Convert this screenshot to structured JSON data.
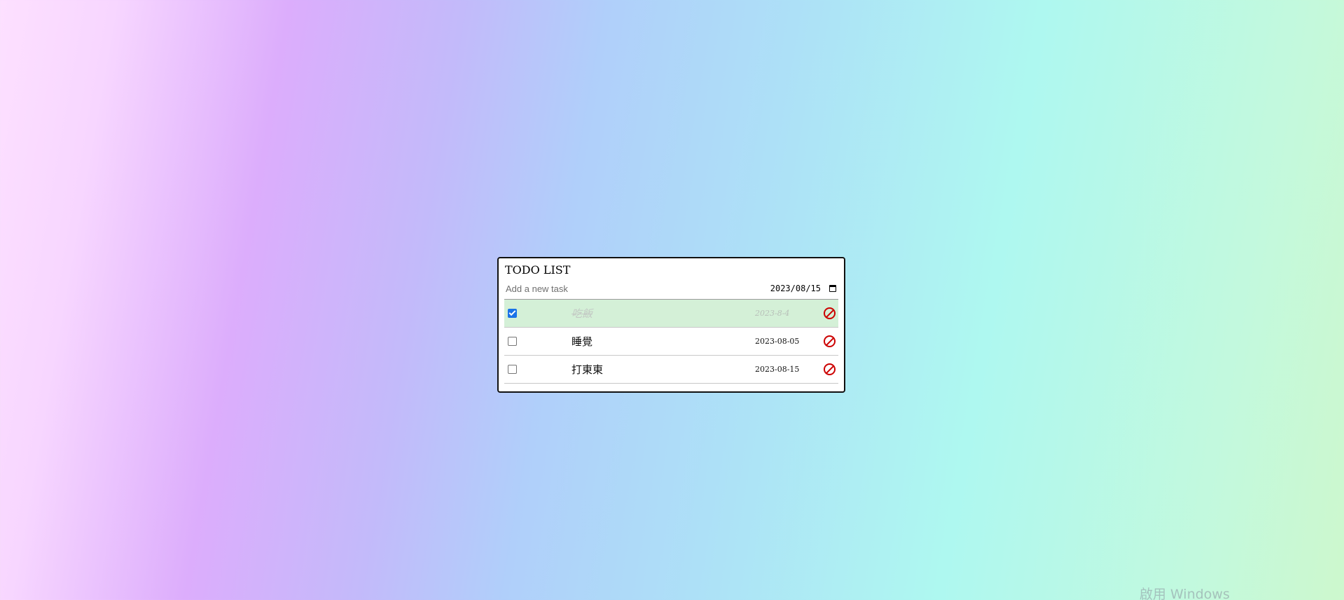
{
  "app": {
    "title": "TODO LIST"
  },
  "add_task": {
    "placeholder": "Add a new task",
    "date_value": "2023/08/15"
  },
  "tasks": [
    {
      "name": "吃飯",
      "date": "2023-8-4",
      "checked": true
    },
    {
      "name": "睡覺",
      "date": "2023-08-05",
      "checked": false
    },
    {
      "name": "打東東",
      "date": "2023-08-15",
      "checked": false
    }
  ],
  "icons": {
    "delete": "prohibit-icon",
    "calendar": "calendar-icon"
  },
  "colors": {
    "done_row": "#d4f0d7",
    "delete": "#cc0000",
    "checkbox_checked": "#1a73e8"
  },
  "os_watermark": "啟用 Windows"
}
